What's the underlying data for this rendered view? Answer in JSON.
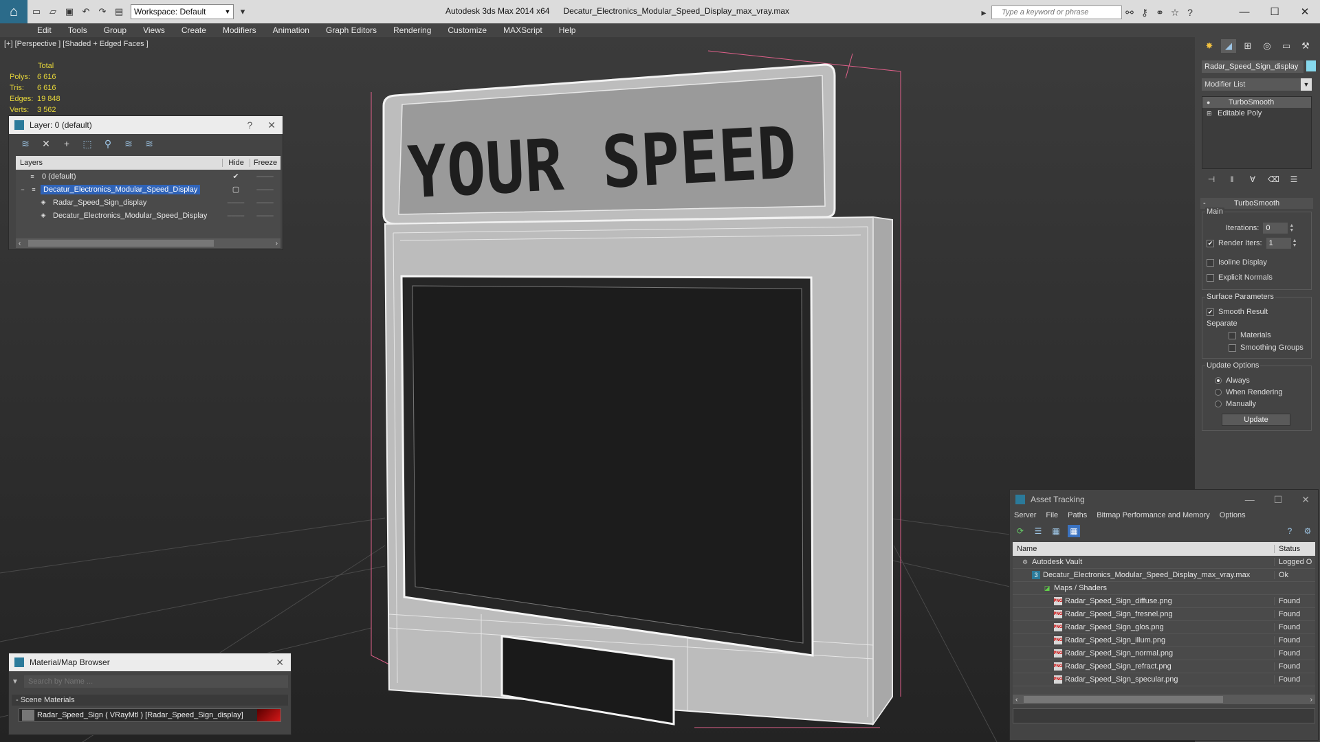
{
  "titlebar": {
    "workspace": "Workspace: Default",
    "app_title": "Autodesk 3ds Max  2014 x64",
    "file_title": "Decatur_Electronics_Modular_Speed_Display_max_vray.max",
    "search_placeholder": "Type a keyword or phrase"
  },
  "menu": [
    "Edit",
    "Tools",
    "Group",
    "Views",
    "Create",
    "Modifiers",
    "Animation",
    "Graph Editors",
    "Rendering",
    "Customize",
    "MAXScript",
    "Help"
  ],
  "viewport": {
    "label": "[+] [Perspective ] [Shaded + Edged Faces ]",
    "stats": {
      "total_label": "Total",
      "rows": [
        {
          "k": "Polys:",
          "v": "6 616"
        },
        {
          "k": "Tris:",
          "v": "6 616"
        },
        {
          "k": "Edges:",
          "v": "19 848"
        },
        {
          "k": "Verts:",
          "v": "3 562"
        }
      ]
    },
    "sign_text": "YOUR SPEED"
  },
  "layer_panel": {
    "title": "Layer: 0 (default)",
    "help": "?",
    "close": "✕",
    "head": {
      "layers": "Layers",
      "hide": "Hide",
      "freeze": "Freeze"
    },
    "rows": [
      {
        "name": "0 (default)",
        "hide": "✔",
        "freeze": "––––"
      },
      {
        "name": "Decatur_Electronics_Modular_Speed_Display",
        "hide": "▢",
        "freeze": "––––"
      },
      {
        "name": "Radar_Speed_Sign_display",
        "hide": "––––",
        "freeze": "––––"
      },
      {
        "name": "Decatur_Electronics_Modular_Speed_Display",
        "hide": "––––",
        "freeze": "––––"
      }
    ]
  },
  "material_browser": {
    "title": "Material/Map Browser",
    "search_placeholder": "Search by Name ...",
    "section": "- Scene Materials",
    "item": "Radar_Speed_Sign  ( VRayMtl ) [Radar_Speed_Sign_display]"
  },
  "command_panel": {
    "object_name": "Radar_Speed_Sign_display",
    "modifier_list": "Modifier List",
    "stack": [
      "TurboSmooth",
      "Editable Poly"
    ],
    "rollout": "TurboSmooth",
    "main_label": "Main",
    "iterations_label": "Iterations:",
    "iterations_value": "0",
    "render_iters_label": "Render Iters:",
    "render_iters_value": "1",
    "isoline": "Isoline Display",
    "explicit_normals": "Explicit Normals",
    "surface_label": "Surface Parameters",
    "smooth_result": "Smooth Result",
    "separate": "Separate",
    "materials": "Materials",
    "smoothing_groups": "Smoothing Groups",
    "update_label": "Update Options",
    "always": "Always",
    "when_rendering": "When Rendering",
    "manually": "Manually",
    "update_button": "Update"
  },
  "asset_tracking": {
    "title": "Asset Tracking",
    "menu": [
      "Server",
      "File",
      "Paths",
      "Bitmap Performance and Memory",
      "Options"
    ],
    "head": {
      "name": "Name",
      "status": "Status"
    },
    "rows": [
      {
        "name": "Autodesk Vault",
        "status": "Logged O",
        "indent": 1,
        "icon": "vault"
      },
      {
        "name": "Decatur_Electronics_Modular_Speed_Display_max_vray.max",
        "status": "Ok",
        "indent": 2,
        "icon": "max"
      },
      {
        "name": "Maps / Shaders",
        "status": "",
        "indent": 3,
        "icon": "maps"
      },
      {
        "name": "Radar_Speed_Sign_diffuse.png",
        "status": "Found",
        "indent": 4,
        "icon": "png"
      },
      {
        "name": "Radar_Speed_Sign_fresnel.png",
        "status": "Found",
        "indent": 4,
        "icon": "png"
      },
      {
        "name": "Radar_Speed_Sign_glos.png",
        "status": "Found",
        "indent": 4,
        "icon": "png"
      },
      {
        "name": "Radar_Speed_Sign_illum.png",
        "status": "Found",
        "indent": 4,
        "icon": "png"
      },
      {
        "name": "Radar_Speed_Sign_normal.png",
        "status": "Found",
        "indent": 4,
        "icon": "png"
      },
      {
        "name": "Radar_Speed_Sign_refract.png",
        "status": "Found",
        "indent": 4,
        "icon": "png"
      },
      {
        "name": "Radar_Speed_Sign_specular.png",
        "status": "Found",
        "indent": 4,
        "icon": "png"
      }
    ]
  }
}
